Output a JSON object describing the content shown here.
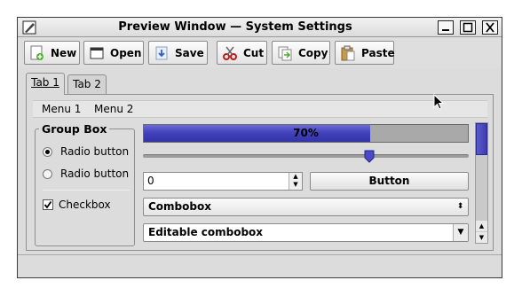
{
  "window": {
    "title": "Preview Window — System Settings",
    "controls": [
      "minimize-icon",
      "maximize-icon",
      "close-icon"
    ]
  },
  "toolbar": [
    {
      "label": "New",
      "icon": "new-document-icon"
    },
    {
      "label": "Open",
      "icon": "open-folder-icon"
    },
    {
      "label": "Save",
      "icon": "save-icon"
    },
    {
      "label": "Cut",
      "icon": "scissors-icon"
    },
    {
      "label": "Copy",
      "icon": "copy-icon"
    },
    {
      "label": "Paste",
      "icon": "paste-icon"
    }
  ],
  "tabs": [
    {
      "label": "Tab 1",
      "active": true
    },
    {
      "label": "Tab 2",
      "active": false
    }
  ],
  "menubar": [
    "Menu 1",
    "Menu 2"
  ],
  "group_box": {
    "title": "Group Box",
    "radios": [
      {
        "label": "Radio button",
        "checked": true
      },
      {
        "label": "Radio button",
        "checked": false
      }
    ],
    "checkbox": {
      "label": "Checkbox",
      "checked": true
    }
  },
  "progress": {
    "value": 0.7,
    "text": "70%"
  },
  "slider": {
    "value": 0.7
  },
  "spinbox": {
    "value": "0"
  },
  "button": {
    "label": "Button"
  },
  "combobox": {
    "value": "Combobox"
  },
  "editable_combobox": {
    "value": "Editable combobox"
  },
  "colors": {
    "accent": "#3f3fb8",
    "window_bg": "#dcdcdc"
  }
}
